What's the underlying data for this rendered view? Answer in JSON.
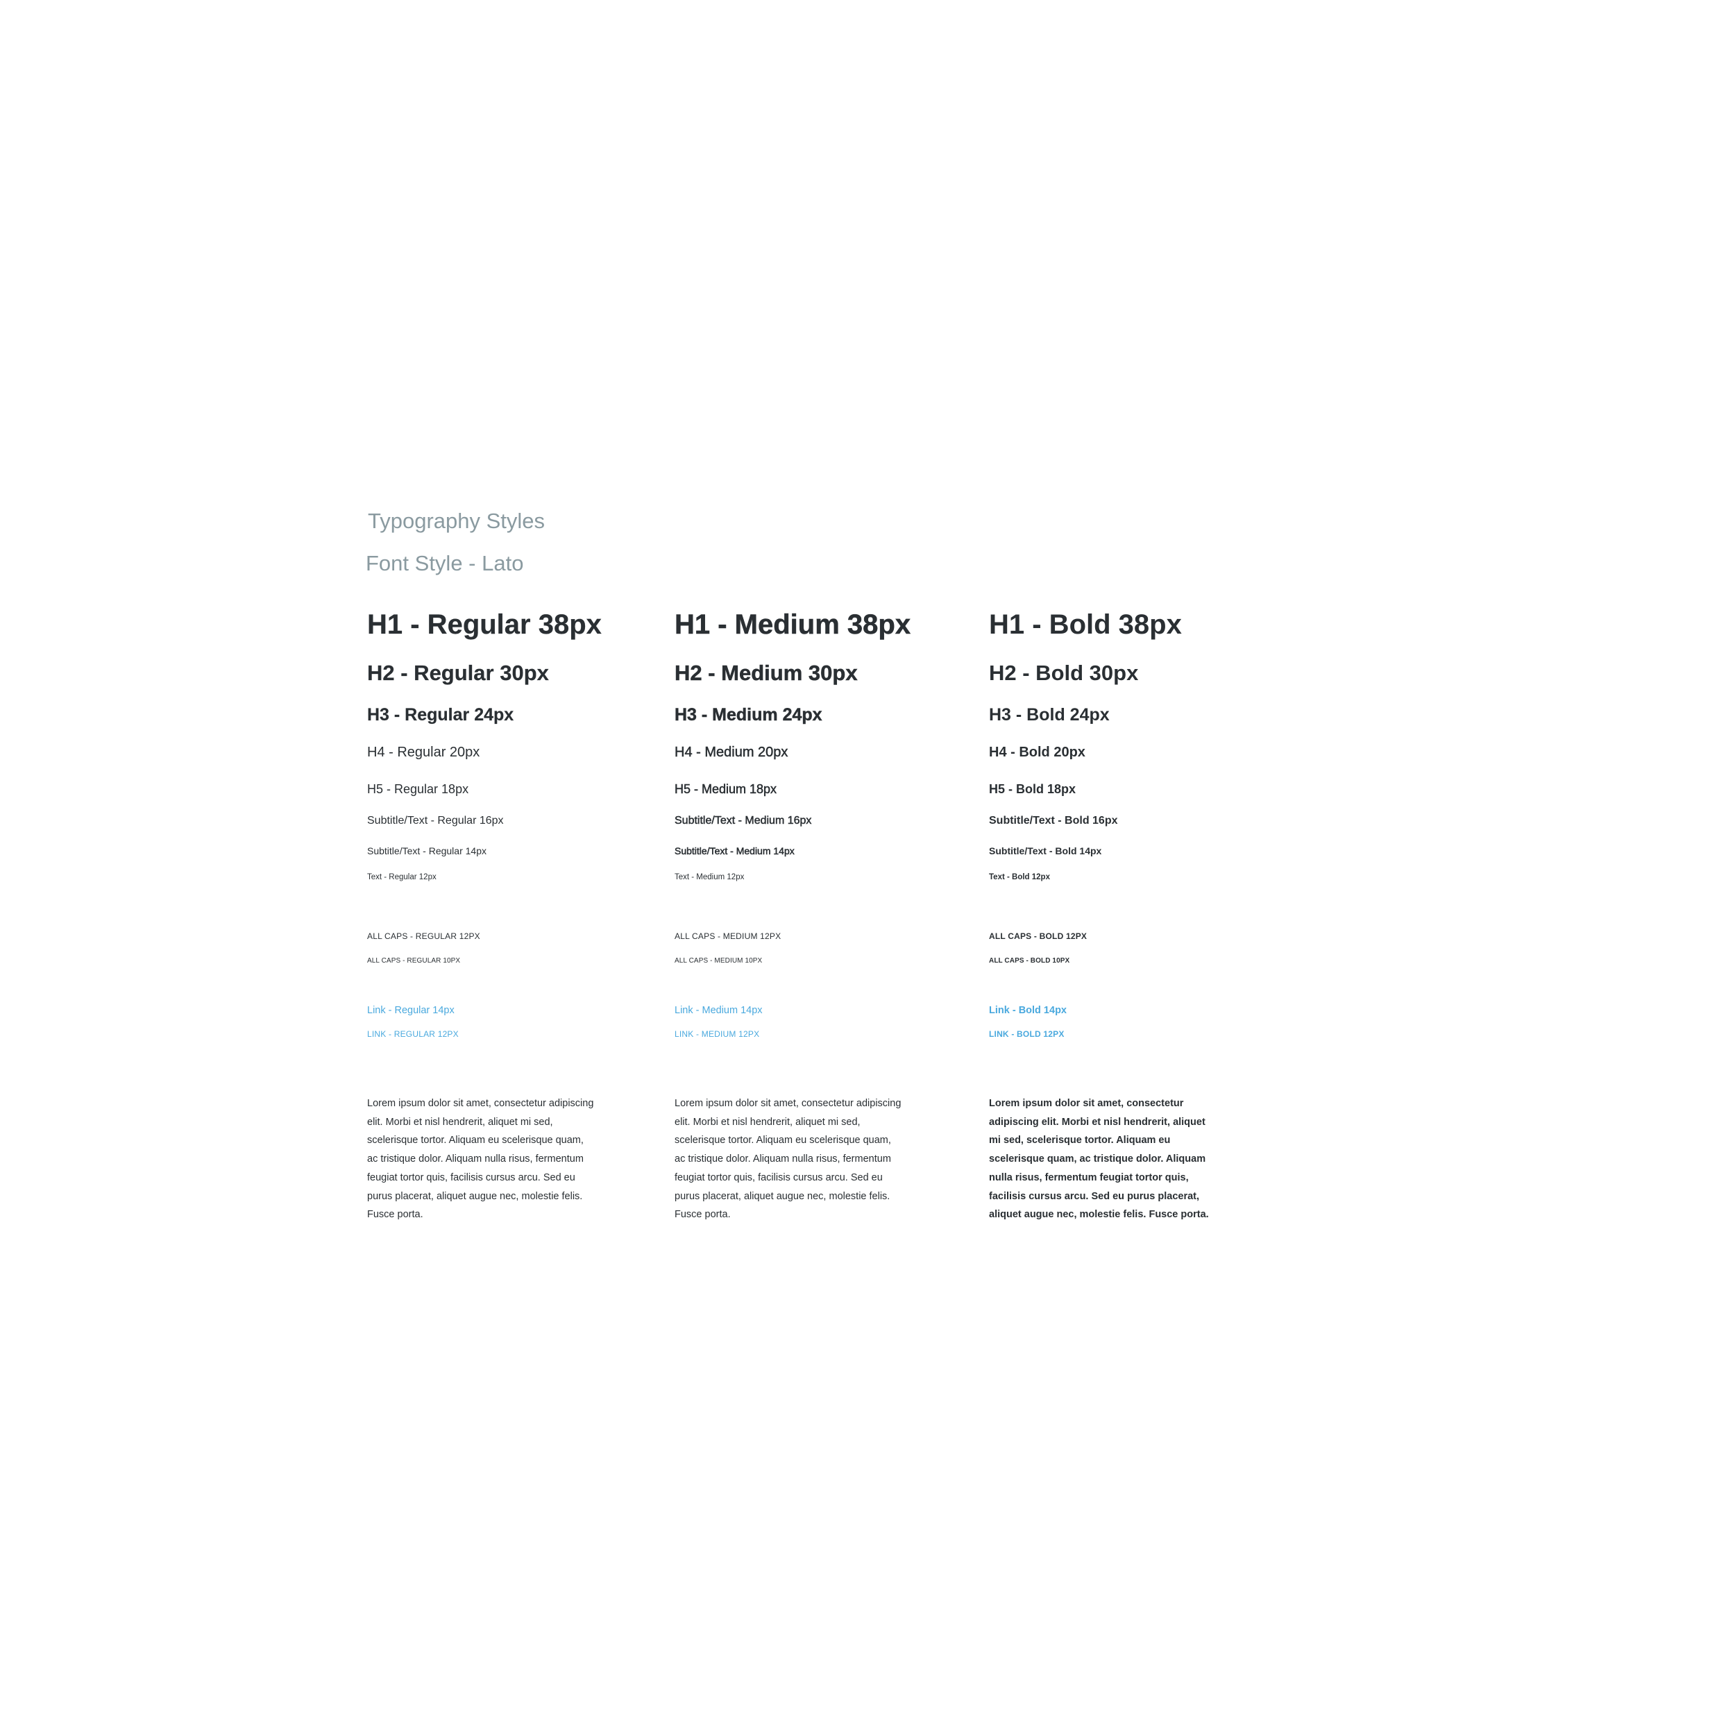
{
  "header": {
    "title": "Typography Styles",
    "font_style": "Font Style - Lato"
  },
  "columns": [
    {
      "h1": "H1 - Regular 38px",
      "h2": "H2 - Regular 30px",
      "h3": "H3 - Regular 24px",
      "h4": "H4 - Regular 20px",
      "h5": "H5 - Regular 18px",
      "subtitle16": "Subtitle/Text - Regular 16px",
      "subtitle14": "Subtitle/Text - Regular 14px",
      "text12": "Text - Regular 12px",
      "caps12": "ALL CAPS - REGULAR 12PX",
      "caps10": "ALL CAPS - REGULAR 10PX",
      "link14": "Link - Regular 14px",
      "link12": "LINK - REGULAR 12PX",
      "paragraph": "Lorem ipsum dolor sit amet, consectetur adipiscing elit. Morbi et nisl hendrerit, aliquet mi sed, scelerisque tortor. Aliquam eu scelerisque quam, ac tristique dolor. Aliquam nulla risus, fermentum feugiat tortor quis, facilisis cursus arcu. Sed eu purus placerat, aliquet augue nec, molestie felis. Fusce porta."
    },
    {
      "h1": "H1 - Medium 38px",
      "h2": "H2 - Medium 30px",
      "h3": "H3 - Medium 24px",
      "h4": "H4 - Medium 20px",
      "h5": "H5 - Medium 18px",
      "subtitle16": "Subtitle/Text - Medium 16px",
      "subtitle14": "Subtitle/Text - Medium 14px",
      "text12": "Text - Medium 12px",
      "caps12": "ALL CAPS - MEDIUM 12PX",
      "caps10": "ALL CAPS - MEDIUM 10PX",
      "link14": "Link - Medium 14px",
      "link12": "LINK - MEDIUM 12PX",
      "paragraph": "Lorem ipsum dolor sit amet, consectetur adipiscing elit. Morbi et nisl hendrerit, aliquet mi sed, scelerisque tortor. Aliquam eu scelerisque quam, ac tristique dolor. Aliquam nulla risus, fermentum feugiat tortor quis, facilisis cursus arcu. Sed eu purus placerat, aliquet augue nec, molestie felis. Fusce porta."
    },
    {
      "h1": "H1 - Bold 38px",
      "h2": "H2 - Bold 30px",
      "h3": "H3 - Bold 24px",
      "h4": "H4 - Bold 20px",
      "h5": "H5 - Bold 18px",
      "subtitle16": "Subtitle/Text - Bold 16px",
      "subtitle14": "Subtitle/Text - Bold 14px",
      "text12": "Text - Bold 12px",
      "caps12": "ALL CAPS - BOLD 12PX",
      "caps10": "ALL CAPS - BOLD 10PX",
      "link14": "Link - Bold 14px",
      "link12": "LINK - BOLD 12PX",
      "paragraph": "Lorem ipsum dolor sit amet, consectetur adipiscing elit. Morbi et nisl hendrerit, aliquet mi sed, scelerisque tortor. Aliquam eu scelerisque quam, ac tristique dolor. Aliquam nulla risus, fermentum feugiat tortor quis, facilisis cursus arcu. Sed eu purus placerat, aliquet augue nec, molestie felis. Fusce porta."
    }
  ],
  "colors": {
    "heading_gray": "#8a9aa0",
    "text": "#2a2f33",
    "link": "#4aa9de"
  }
}
